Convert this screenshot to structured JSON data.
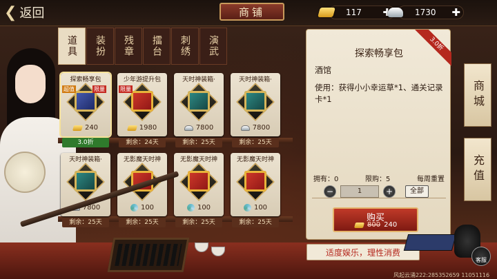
{
  "header": {
    "back_label": "返回",
    "title": "商铺",
    "gold_amount": "117",
    "silver_amount": "1730"
  },
  "tabs": [
    {
      "label": "道具",
      "active": true
    },
    {
      "label": "装扮",
      "active": false
    },
    {
      "label": "残章",
      "active": false
    },
    {
      "label": "擂台",
      "active": false
    },
    {
      "label": "刺绣",
      "active": false
    },
    {
      "label": "演武",
      "active": false
    }
  ],
  "items": [
    {
      "name": "探索畅享包",
      "badge_super": "超值",
      "badge_limit": "限量",
      "icon": "chest-icon",
      "currency": "gold",
      "price": "240",
      "sub": "3.0折",
      "sub_style": "discount"
    },
    {
      "name": "少年游提升包",
      "badge_limit": "限量",
      "icon": "red-gift-icon",
      "currency": "gold",
      "price": "1980",
      "sub": "剩余：24天"
    },
    {
      "name": "天时神装箱·",
      "icon": "gold-chest-icon",
      "currency": "silver",
      "price": "7800",
      "sub": "剩余：25天"
    },
    {
      "name": "天时神装箱·",
      "icon": "gold-chest-icon",
      "currency": "silver",
      "price": "7800",
      "sub": "剩余：25天"
    },
    {
      "name": "天时神装箱·",
      "icon": "teal-chest-icon",
      "currency": "silver",
      "price": "7800",
      "sub": "剩余：25天"
    },
    {
      "name": "无影魔天时神",
      "icon": "red-gift-icon",
      "currency": "gem",
      "price": "100",
      "sub": "剩余：25天"
    },
    {
      "name": "无影魔天时神",
      "icon": "red-gift-icon",
      "currency": "gem",
      "price": "100",
      "sub": "剩余：25天"
    },
    {
      "name": "无影魔天时神",
      "icon": "red-gift-icon",
      "currency": "gem",
      "price": "100",
      "sub": "剩余：25天"
    }
  ],
  "detail": {
    "discount_ribbon": "3.0折",
    "title": "探索畅享包",
    "category": "酒馆",
    "description": "使用：获得小小幸运草*1、通关记录卡*1",
    "owned": "拥有：0",
    "limit": "限购：5",
    "reset": "每周重置",
    "quantity": "1",
    "all_label": "全部",
    "buy_label": "购买",
    "original_price": "800",
    "current_price": "240"
  },
  "side": {
    "shop_city": "商城",
    "recharge": "充值",
    "service": "客服"
  },
  "slogan": "适度娱乐，理性消费",
  "footer_id": "风起云涌222:285352659 11051116"
}
